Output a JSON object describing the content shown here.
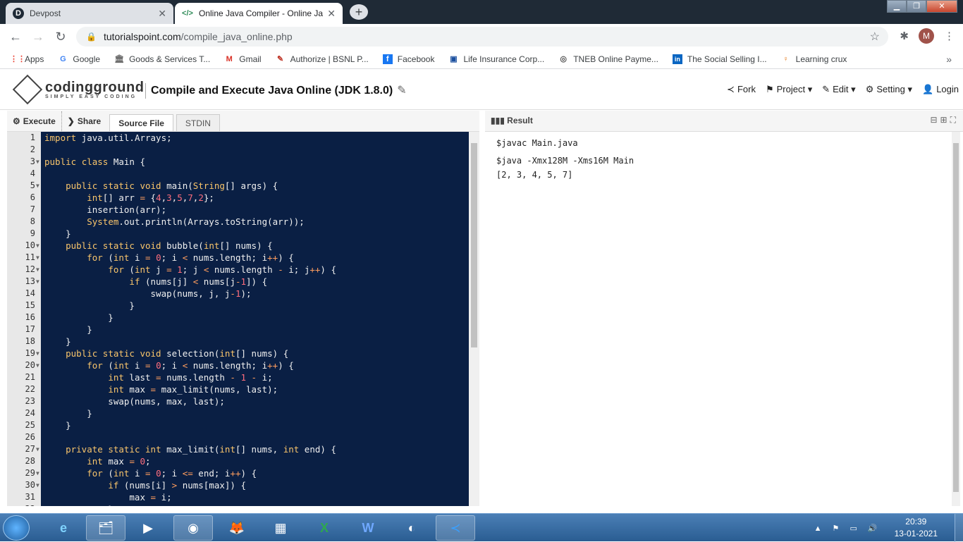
{
  "browser": {
    "tabs": [
      {
        "title": "Devpost",
        "icon": "D"
      },
      {
        "title": "Online Java Compiler - Online Ja",
        "icon": "</>"
      }
    ],
    "url_host": "tutorialspoint.com",
    "url_path": "/compile_java_online.php",
    "profile_initial": "M",
    "bookmarks": [
      {
        "label": "Apps",
        "icon": "⋮⋮",
        "color": "#ea4335"
      },
      {
        "label": "Google",
        "icon": "G",
        "color": "#4285f4"
      },
      {
        "label": "Goods & Services T...",
        "icon": "🏛",
        "color": "#6d6d6d"
      },
      {
        "label": "Gmail",
        "icon": "M",
        "color": "#d93025"
      },
      {
        "label": "Authorize | BSNL P...",
        "icon": "✎",
        "color": "#c0392b"
      },
      {
        "label": "Facebook",
        "icon": "f",
        "color": "#1877f2"
      },
      {
        "label": "Life Insurance Corp...",
        "icon": "▣",
        "color": "#1a4f9e"
      },
      {
        "label": "TNEB Online Payme...",
        "icon": "◎",
        "color": "#555555"
      },
      {
        "label": "The Social Selling I...",
        "icon": "in",
        "color": "#0a66c2"
      },
      {
        "label": "Learning crux",
        "icon": "♀",
        "color": "#e67e22"
      }
    ]
  },
  "site": {
    "logo_main": "codingground",
    "logo_tagline": "SIMPLY EASY CODING",
    "title": "Compile and Execute Java Online (JDK 1.8.0)",
    "nav": [
      "Fork",
      "Project",
      "Edit",
      "Setting",
      "Login"
    ]
  },
  "editor_toolbar": {
    "execute": "Execute",
    "share": "Share",
    "tabs": [
      "Source File",
      "STDIN"
    ]
  },
  "code": [
    "import java.util.Arrays;",
    "",
    "public class Main {",
    "",
    "    public static void main(String[] args) {",
    "        int[] arr = {4,3,5,7,2};",
    "        insertion(arr);",
    "        System.out.println(Arrays.toString(arr));",
    "    }",
    "    public static void bubble(int[] nums) {",
    "        for (int i = 0; i < nums.length; i++) {",
    "            for (int j = 1; j < nums.length - i; j++) {",
    "                if (nums[j] < nums[j-1]) {",
    "                    swap(nums, j, j-1);",
    "                }",
    "            }",
    "        }",
    "    }",
    "    public static void selection(int[] nums) {",
    "        for (int i = 0; i < nums.length; i++) {",
    "            int last = nums.length - 1 - i;",
    "            int max = max_limit(nums, last);",
    "            swap(nums, max, last);",
    "        }",
    "    }",
    "",
    "    private static int max_limit(int[] nums, int end) {",
    "        int max = 0;",
    "        for (int i = 0; i <= end; i++) {",
    "            if (nums[i] > nums[max]) {",
    "                max = i;",
    "            }"
  ],
  "fold_lines": [
    3,
    5,
    10,
    11,
    12,
    13,
    19,
    20,
    27,
    29,
    30
  ],
  "result": {
    "title": "Result",
    "lines": [
      "$javac Main.java",
      "$java -Xmx128M -Xms16M Main",
      "[2, 3, 4, 5, 7]"
    ]
  },
  "taskbar": {
    "apps": [
      "ie-icon",
      "explorer-icon",
      "media-player-icon",
      "chrome-icon",
      "firefox-icon",
      "calculator-icon",
      "excel-icon",
      "word-icon",
      "eclipse-icon",
      "vscode-icon"
    ],
    "time": "20:39",
    "date": "13-01-2021"
  }
}
